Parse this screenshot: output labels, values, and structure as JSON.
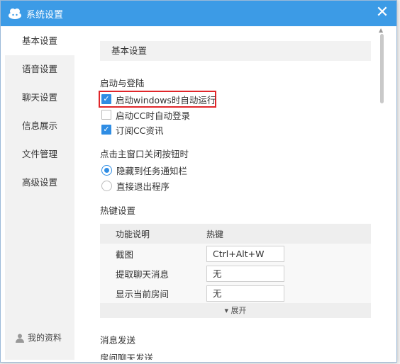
{
  "window": {
    "title": "系统设置"
  },
  "sidebar": {
    "items": [
      {
        "label": "基本设置"
      },
      {
        "label": "语音设置"
      },
      {
        "label": "聊天设置"
      },
      {
        "label": "信息展示"
      },
      {
        "label": "文件管理"
      },
      {
        "label": "高级设置"
      }
    ],
    "profile_label": "我的资料"
  },
  "main": {
    "section_title": "基本设置",
    "startup": {
      "heading": "启动与登陆",
      "options": [
        {
          "label": "启动windows时自动运行",
          "checked": true
        },
        {
          "label": "启动CC时自动登录",
          "checked": false
        },
        {
          "label": "订阅CC资讯",
          "checked": true
        }
      ]
    },
    "close_behavior": {
      "heading": "点击主窗口关闭按钮时",
      "options": [
        {
          "label": "隐藏到任务通知栏",
          "selected": true
        },
        {
          "label": "直接退出程序",
          "selected": false
        }
      ]
    },
    "hotkeys": {
      "heading": "热键设置",
      "col_function": "功能说明",
      "col_hotkey": "热键",
      "rows": [
        {
          "name": "截图",
          "value": "Ctrl+Alt+W"
        },
        {
          "name": "提取聊天消息",
          "value": "无"
        },
        {
          "name": "显示当前房间",
          "value": "无"
        }
      ],
      "expand_label": "展开"
    },
    "message": {
      "heading": "消息发送",
      "sub": "房间聊天发送"
    }
  },
  "colors": {
    "titlebar": "#3c9be6",
    "accent": "#2f8de4",
    "highlight": "#e0262a"
  }
}
